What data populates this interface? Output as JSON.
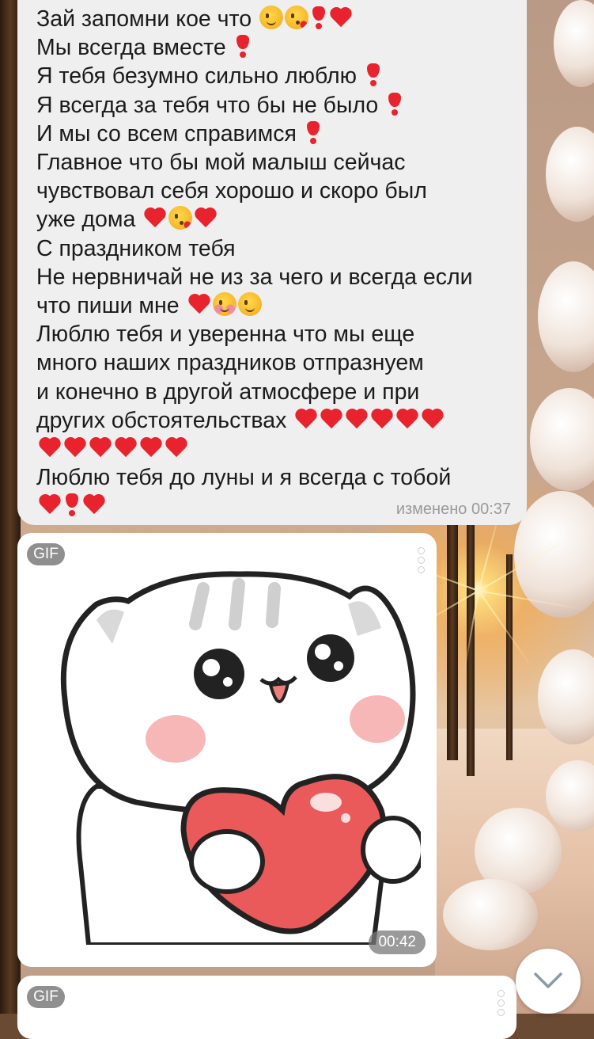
{
  "message": {
    "lines": [
      {
        "text": "Зай запомни кое что",
        "emoji": [
          "face-wink",
          "face-kiss",
          "exclamation",
          "heart"
        ]
      },
      {
        "text": "Мы всегда вместе",
        "emoji": [
          "exclamation"
        ]
      },
      {
        "text": "Я тебя безумно сильно люблю",
        "emoji": [
          "exclamation"
        ]
      },
      {
        "text": "Я всегда за тебя что бы не было",
        "emoji": [
          "exclamation"
        ]
      },
      {
        "text": "И мы со всем справимся",
        "emoji": [
          "exclamation"
        ]
      },
      {
        "text": "Главное что бы мой малыш сейчас",
        "emoji": []
      },
      {
        "text": "чувствовал себя хорошо и скоро был",
        "emoji": []
      },
      {
        "text": "уже дома",
        "emoji": [
          "heart",
          "face-kiss",
          "heart"
        ]
      },
      {
        "text": "С праздником тебя",
        "emoji": []
      },
      {
        "text": "Не нервничай не из за чего и всегда если",
        "emoji": []
      },
      {
        "text": "что пиши мне",
        "emoji": [
          "heart",
          "face-blush",
          "face-wink"
        ]
      },
      {
        "text": "Люблю тебя и уверенна что мы еще",
        "emoji": []
      },
      {
        "text": "много наших праздников отпразнуем",
        "emoji": []
      },
      {
        "text": "и конечно в другой атмосфере и при",
        "emoji": []
      },
      {
        "text": "других обстоятельствах",
        "emoji": [
          "heart",
          "heart",
          "heart",
          "heart",
          "heart",
          "heart"
        ]
      },
      {
        "text": "",
        "emoji": [
          "heart",
          "heart",
          "heart",
          "heart",
          "heart",
          "heart"
        ]
      },
      {
        "text": "Люблю тебя до луны и я всегда с тобой",
        "emoji": []
      },
      {
        "text": "",
        "emoji": [
          "heart",
          "exclamation",
          "heart"
        ]
      }
    ],
    "meta": "изменено 00:37"
  },
  "gif1": {
    "badge": "GIF",
    "time": "00:42",
    "sticker_icon": "cat-holding-heart-sticker"
  },
  "gif2": {
    "badge": "GIF"
  },
  "scroll_button_icon": "chevron-down-icon"
}
